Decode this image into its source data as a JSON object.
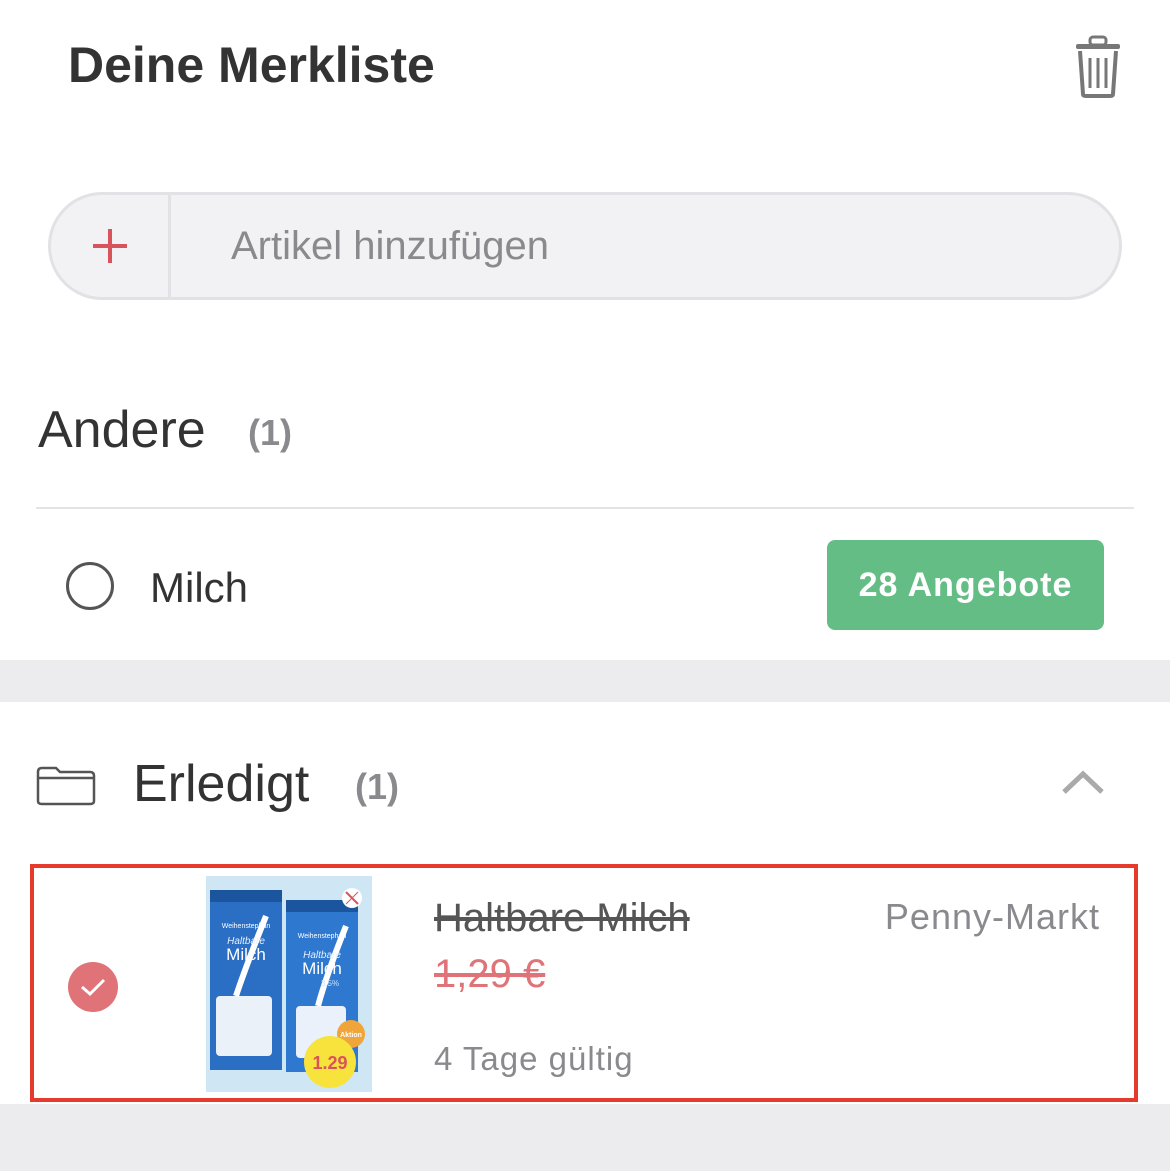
{
  "header": {
    "title": "Deine Merkliste",
    "trash_icon": "trash-icon"
  },
  "add_bar": {
    "plus_icon": "plus-icon",
    "placeholder": "Artikel hinzufügen",
    "value": ""
  },
  "section_other": {
    "title": "Andere",
    "count": "(1)",
    "items": [
      {
        "label": "Milch",
        "checked": false,
        "offers_label": "28 Angebote"
      }
    ]
  },
  "section_done": {
    "folder_icon": "folder-icon",
    "title": "Erledigt",
    "count": "(1)",
    "collapse_icon": "chevron-up-icon",
    "items": [
      {
        "checked": true,
        "product_name": "Haltbare Milch",
        "price": "1,29 €",
        "validity": "4 Tage gültig",
        "store": "Penny-Markt",
        "image": {
          "brand": "Weihenstephan",
          "line1": "Haltbare",
          "line2": "Milch",
          "fat": "3,5%",
          "badge": "Aktion",
          "price_tag": "1.29"
        }
      }
    ]
  },
  "colors": {
    "accent_red": "#e07378",
    "offers_green": "#65bd86",
    "highlight_border": "#e53a2c"
  }
}
